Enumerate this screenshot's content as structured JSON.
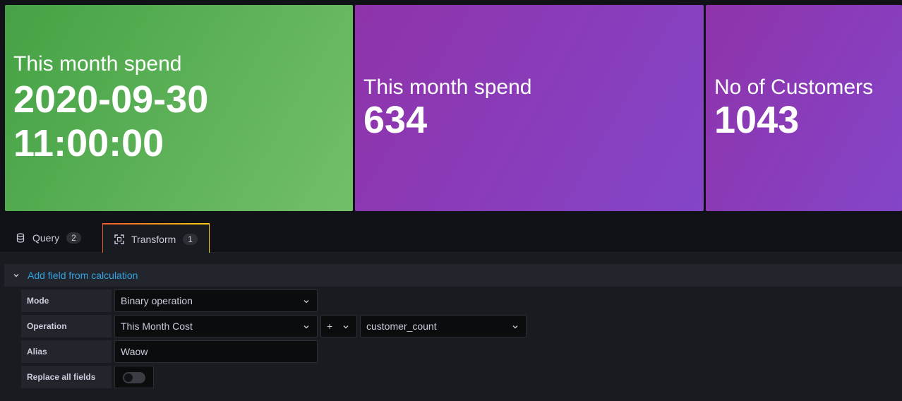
{
  "stats": [
    {
      "title": "This month spend",
      "value_line1": "2020-09-30",
      "value_line2": "11:00:00",
      "color": "#56a64b"
    },
    {
      "title": "This month spend",
      "value": "634",
      "color": "#8f3bb8"
    },
    {
      "title": "No of Customers",
      "value": "1043",
      "color": "#8f3bb8"
    }
  ],
  "tabs": [
    {
      "label": "Query",
      "count": "2",
      "icon": "database-icon"
    },
    {
      "label": "Transform",
      "count": "1",
      "icon": "transform-icon",
      "active": true
    }
  ],
  "transformation": {
    "title": "Add field from calculation",
    "mode_label": "Mode",
    "mode_value": "Binary operation",
    "operation_label": "Operation",
    "operation_left": "This Month Cost",
    "operation_operator": "+",
    "operation_right": "customer_count",
    "alias_label": "Alias",
    "alias_value": "Waow",
    "replace_label": "Replace all fields",
    "replace_on": false
  },
  "colors": {
    "accent_link": "#33a2e5",
    "tab_accent_start": "#f05a28",
    "tab_accent_end": "#fbca0a"
  }
}
